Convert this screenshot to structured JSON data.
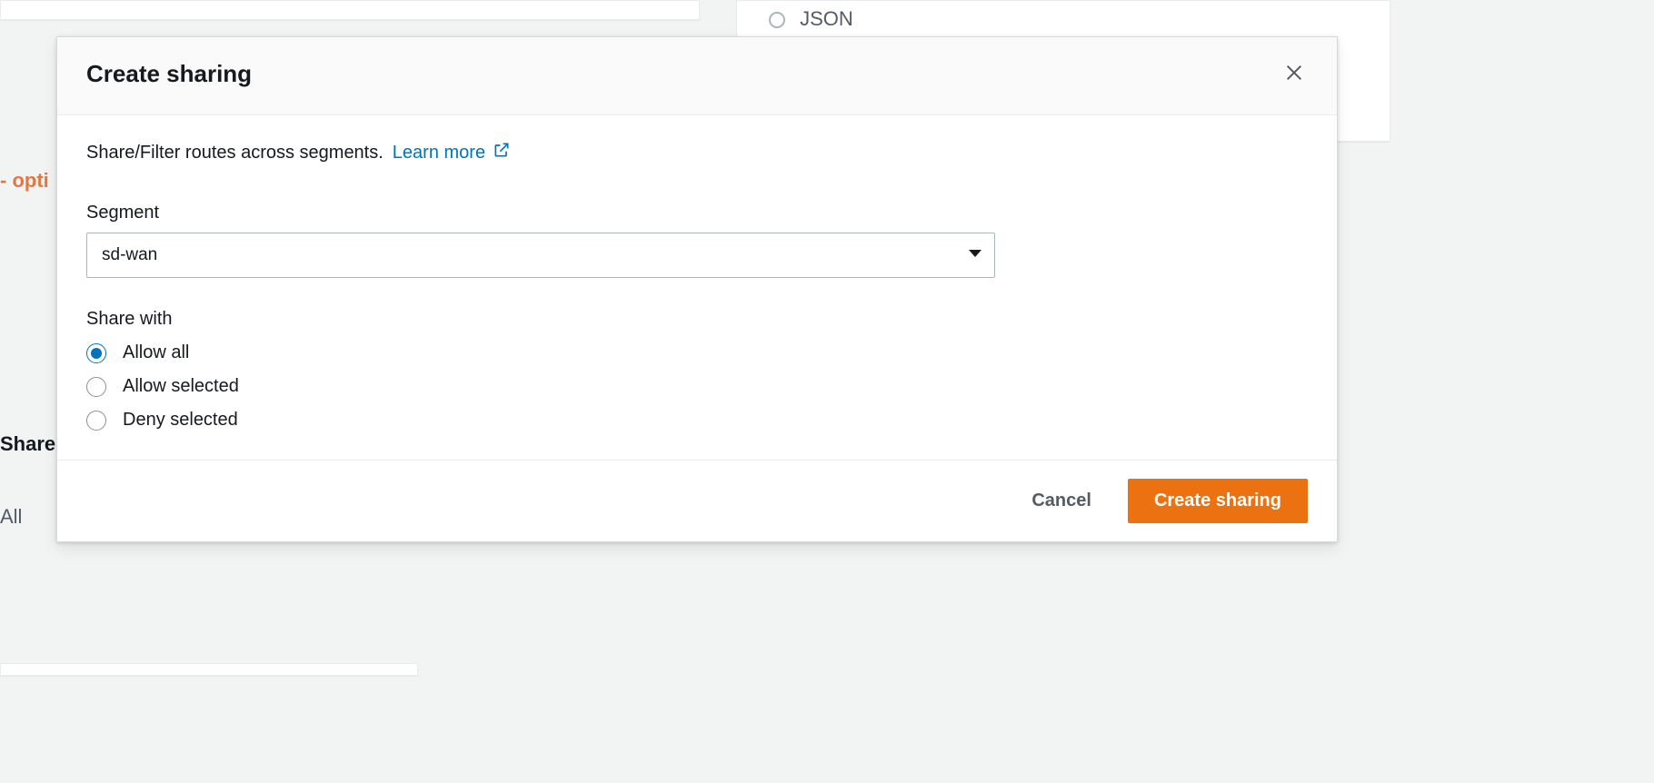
{
  "background": {
    "optional_fragment": "- opti",
    "share_fragment": "Share",
    "all_fragment": "All",
    "json_fragment": "JSON"
  },
  "modal": {
    "title": "Create sharing",
    "intro": "Share/Filter routes across segments.",
    "learn_more": "Learn more",
    "segment": {
      "label": "Segment",
      "value": "sd-wan"
    },
    "share_with": {
      "label": "Share with",
      "options": [
        {
          "label": "Allow all",
          "selected": true
        },
        {
          "label": "Allow selected",
          "selected": false
        },
        {
          "label": "Deny selected",
          "selected": false
        }
      ]
    },
    "footer": {
      "cancel": "Cancel",
      "submit": "Create sharing"
    }
  }
}
